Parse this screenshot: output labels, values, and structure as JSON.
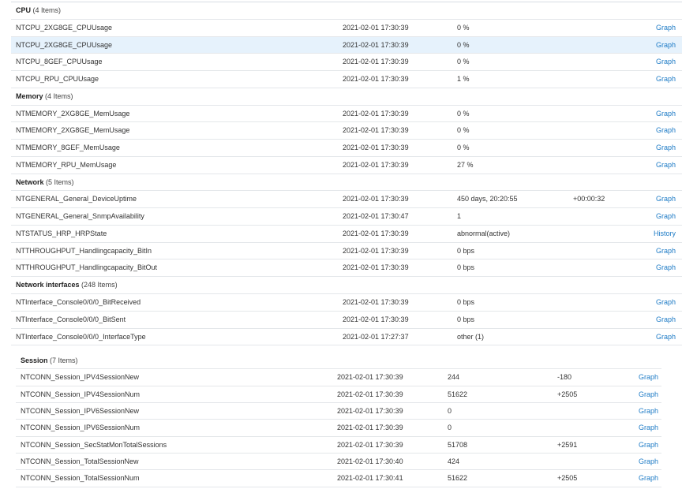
{
  "sections": [
    {
      "title": "CPU",
      "count": "(4 Items)",
      "rows": [
        {
          "name": "NTCPU_2XG8GE_CPUUsage",
          "time": "2021-02-01 17:30:39",
          "value": "0 %",
          "change": "",
          "action": "Graph"
        },
        {
          "name": "NTCPU_2XG8GE_CPUUsage",
          "time": "2021-02-01 17:30:39",
          "value": "0 %",
          "change": "",
          "action": "Graph"
        },
        {
          "name": "NTCPU_8GEF_CPUUsage",
          "time": "2021-02-01 17:30:39",
          "value": "0 %",
          "change": "",
          "action": "Graph"
        },
        {
          "name": "NTCPU_RPU_CPUUsage",
          "time": "2021-02-01 17:30:39",
          "value": "1 %",
          "change": "",
          "action": "Graph"
        }
      ]
    },
    {
      "title": "Memory",
      "count": "(4 Items)",
      "rows": [
        {
          "name": "NTMEMORY_2XG8GE_MemUsage",
          "time": "2021-02-01 17:30:39",
          "value": "0 %",
          "change": "",
          "action": "Graph"
        },
        {
          "name": "NTMEMORY_2XG8GE_MemUsage",
          "time": "2021-02-01 17:30:39",
          "value": "0 %",
          "change": "",
          "action": "Graph"
        },
        {
          "name": "NTMEMORY_8GEF_MemUsage",
          "time": "2021-02-01 17:30:39",
          "value": "0 %",
          "change": "",
          "action": "Graph"
        },
        {
          "name": "NTMEMORY_RPU_MemUsage",
          "time": "2021-02-01 17:30:39",
          "value": "27 %",
          "change": "",
          "action": "Graph"
        }
      ]
    },
    {
      "title": "Network",
      "count": "(5 Items)",
      "rows": [
        {
          "name": "NTGENERAL_General_DeviceUptime",
          "time": "2021-02-01 17:30:39",
          "value": "450 days, 20:20:55",
          "change": "+00:00:32",
          "action": "Graph"
        },
        {
          "name": "NTGENERAL_General_SnmpAvailability",
          "time": "2021-02-01 17:30:47",
          "value": "1",
          "change": "",
          "action": "Graph"
        },
        {
          "name": "NTSTATUS_HRP_HRPState",
          "time": "2021-02-01 17:30:39",
          "value": "abnormal(active)",
          "change": "",
          "action": "History"
        },
        {
          "name": "NTTHROUGHPUT_Handlingcapacity_BitIn",
          "time": "2021-02-01 17:30:39",
          "value": "0 bps",
          "change": "",
          "action": "Graph"
        },
        {
          "name": "NTTHROUGHPUT_Handlingcapacity_BitOut",
          "time": "2021-02-01 17:30:39",
          "value": "0 bps",
          "change": "",
          "action": "Graph"
        }
      ]
    },
    {
      "title": "Network interfaces",
      "count": "(248 Items)",
      "rows": [
        {
          "name": "NTInterface_Console0/0/0_BitReceived",
          "time": "2021-02-01 17:30:39",
          "value": "0 bps",
          "change": "",
          "action": "Graph"
        },
        {
          "name": "NTInterface_Console0/0/0_BitSent",
          "time": "2021-02-01 17:30:39",
          "value": "0 bps",
          "change": "",
          "action": "Graph"
        },
        {
          "name": "NTInterface_Console0/0/0_InterfaceType",
          "time": "2021-02-01 17:27:37",
          "value": "other (1)",
          "change": "",
          "action": "Graph"
        }
      ]
    }
  ],
  "session": {
    "title": "Session",
    "count": "(7 Items)",
    "rows": [
      {
        "name": "NTCONN_Session_IPV4SessionNew",
        "time": "2021-02-01 17:30:39",
        "value": "244",
        "change": "-180",
        "action": "Graph"
      },
      {
        "name": "NTCONN_Session_IPV4SessionNum",
        "time": "2021-02-01 17:30:39",
        "value": "51622",
        "change": "+2505",
        "action": "Graph"
      },
      {
        "name": "NTCONN_Session_IPV6SessionNew",
        "time": "2021-02-01 17:30:39",
        "value": "0",
        "change": "",
        "action": "Graph"
      },
      {
        "name": "NTCONN_Session_IPV6SessionNum",
        "time": "2021-02-01 17:30:39",
        "value": "0",
        "change": "",
        "action": "Graph"
      },
      {
        "name": "NTCONN_Session_SecStatMonTotalSessions",
        "time": "2021-02-01 17:30:39",
        "value": "51708",
        "change": "+2591",
        "action": "Graph"
      },
      {
        "name": "NTCONN_Session_TotalSessionNew",
        "time": "2021-02-01 17:30:40",
        "value": "424",
        "change": "",
        "action": "Graph"
      },
      {
        "name": "NTCONN_Session_TotalSessionNum",
        "time": "2021-02-01 17:30:41",
        "value": "51622",
        "change": "+2505",
        "action": "Graph"
      }
    ]
  },
  "colors": {
    "link": "#1d7bc6",
    "row_hover": "#e6f2fc",
    "border": "#e4e7ea"
  }
}
